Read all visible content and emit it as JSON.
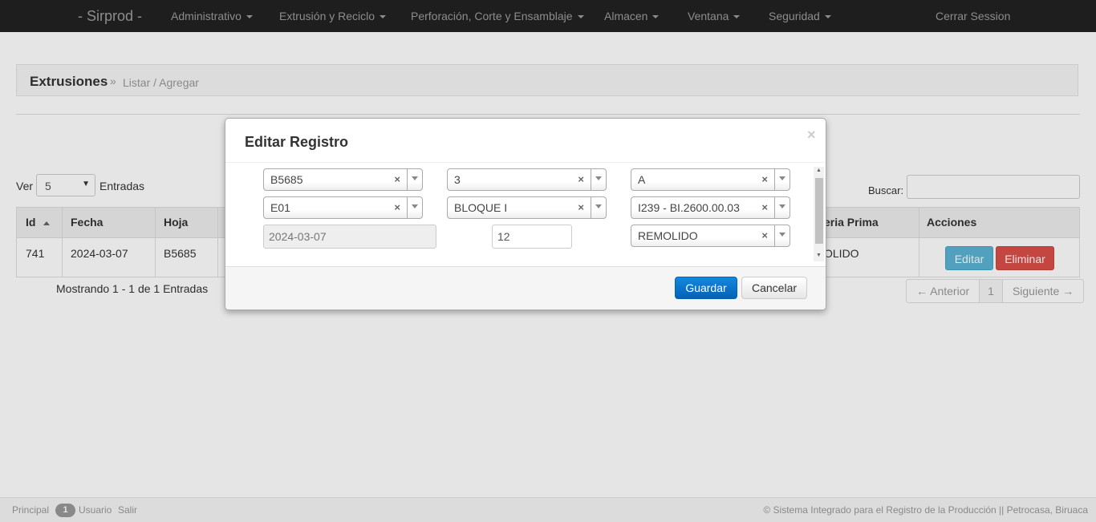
{
  "navbar": {
    "brand": "- Sirprod -",
    "items": [
      {
        "label": "Administrativo",
        "dropdown": true
      },
      {
        "label": "Extrusión y Reciclo",
        "dropdown": true
      },
      {
        "label": "Perforación, Corte y Ensamblaje",
        "dropdown": true
      },
      {
        "label": "Almacen",
        "dropdown": true
      },
      {
        "label": "Ventana",
        "dropdown": true
      },
      {
        "label": "Seguridad",
        "dropdown": true
      }
    ],
    "logout": "Cerrar Session"
  },
  "breadcrumb": {
    "title": "Extrusiones",
    "separator": "»",
    "subtitle": "Listar / Agregar"
  },
  "table_controls": {
    "ver_label": "Ver",
    "page_size": "5",
    "entradas_label": "Entradas",
    "buscar_label": "Buscar:"
  },
  "table": {
    "columns": [
      "Id",
      "Fecha",
      "Hoja",
      "eria Prima",
      "Acciones"
    ],
    "rows": [
      {
        "id": "741",
        "fecha": "2024-03-07",
        "hoja": "B5685",
        "materia": "OLIDO"
      }
    ],
    "edit_label": "Editar",
    "delete_label": "Eliminar"
  },
  "pagination": {
    "info": "Mostrando 1 - 1 de 1 Entradas",
    "prev": "← Anterior",
    "page": "1",
    "next": "Siguiente →"
  },
  "modal": {
    "title": "Editar Registro",
    "close": "×",
    "fields": {
      "hoja": "B5685",
      "turno": "3",
      "grupo": "A",
      "maquina": "E01",
      "bloque": "BLOQUE I",
      "producto": "I239 - BI.2600.00.03",
      "fecha": "2024-03-07",
      "cantidad": "12",
      "materia_prima": "REMOLIDO"
    },
    "save_label": "Guardar",
    "cancel_label": "Cancelar"
  },
  "footer": {
    "principal": "Principal",
    "badge": "1",
    "usuario": "Usuario",
    "salir": "Salir",
    "copyright": "© Sistema Integrado para el Registro de la Producción || Petrocasa, Biruaca"
  },
  "colors": {
    "navbar_bg": "#222222",
    "primary": "#0a72c7",
    "info": "#5bb3d4",
    "danger": "#da4f49"
  }
}
